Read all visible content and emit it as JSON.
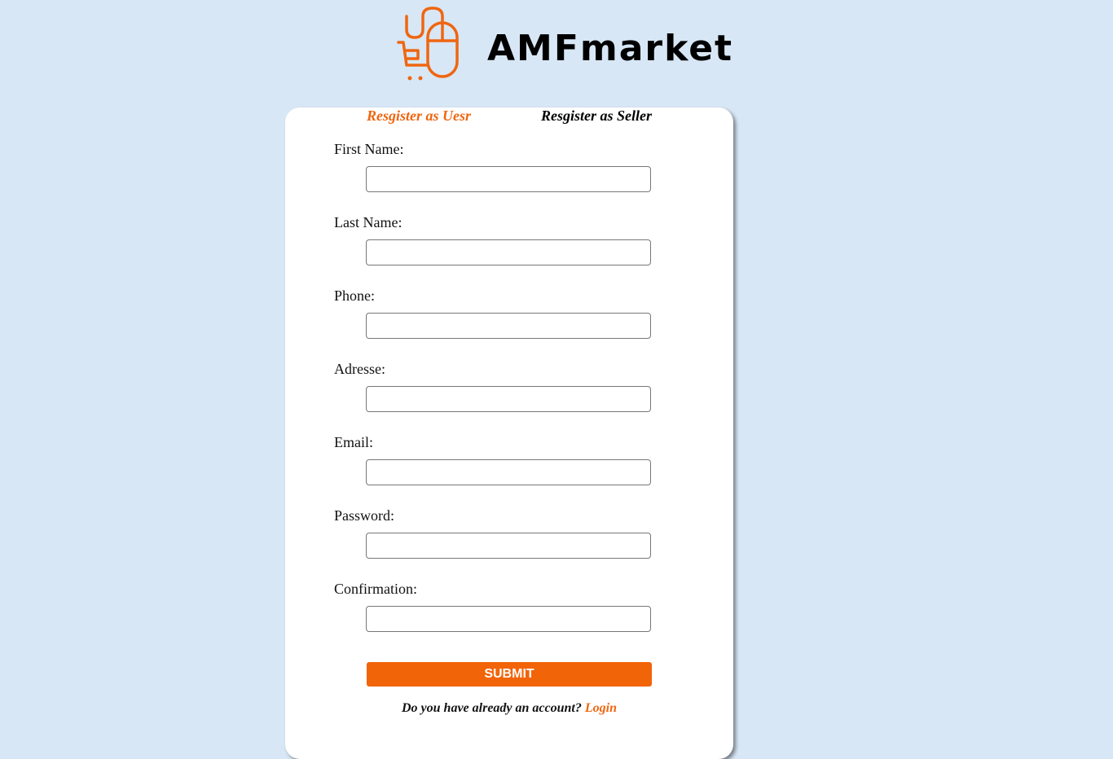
{
  "brand": {
    "name": "AMFmarket",
    "accent_color": "#f26408",
    "logo_icon": "mouse-cart-icon"
  },
  "tabs": {
    "user": "Resgister as Uesr",
    "seller": "Resgister as Seller"
  },
  "form": {
    "fields": [
      {
        "label": "First Name:",
        "value": ""
      },
      {
        "label": "Last Name:",
        "value": ""
      },
      {
        "label": "Phone:",
        "value": ""
      },
      {
        "label": "Adresse:",
        "value": ""
      },
      {
        "label": "Email:",
        "value": ""
      },
      {
        "label": "Password:",
        "value": ""
      },
      {
        "label": "Confirmation:",
        "value": ""
      }
    ],
    "submit_label": "SUBMIT"
  },
  "footer": {
    "question": "Do you have already an account?",
    "login_label": "Login"
  },
  "colors": {
    "background": "#d8e7f5",
    "card": "#ffffff",
    "accent": "#f26408"
  }
}
